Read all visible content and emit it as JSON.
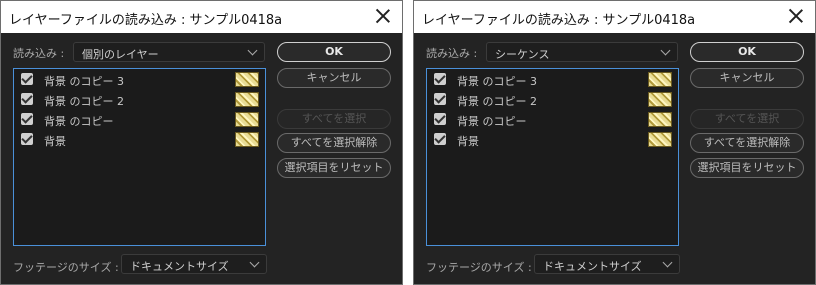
{
  "dialogs": [
    {
      "title": "レイヤーファイルの読み込み : サンプル0418a",
      "import_label": "読み込み :",
      "import_value": "個別のレイヤー",
      "layers": [
        "背景 のコピー 3",
        "背景 のコピー 2",
        "背景 のコピー",
        "背景"
      ],
      "buttons": {
        "ok": "OK",
        "cancel": "キャンセル",
        "select_all": "すべてを選択",
        "deselect_all": "すべてを選択解除",
        "reset": "選択項目をリセット"
      },
      "footage_label": "フッテージのサイズ :",
      "footage_value": "ドキュメントサイズ"
    },
    {
      "title": "レイヤーファイルの読み込み : サンプル0418a",
      "import_label": "読み込み :",
      "import_value": "シーケンス",
      "layers": [
        "背景 のコピー 3",
        "背景 のコピー 2",
        "背景 のコピー",
        "背景"
      ],
      "buttons": {
        "ok": "OK",
        "cancel": "キャンセル",
        "select_all": "すべてを選択",
        "deselect_all": "すべてを選択解除",
        "reset": "選択項目をリセット"
      },
      "footage_label": "フッテージのサイズ :",
      "footage_value": "ドキュメントサイズ"
    }
  ],
  "colors": {
    "dialog_bg": "#232323",
    "list_border": "#4a90d9",
    "titlebar_bg": "#ffffff"
  }
}
